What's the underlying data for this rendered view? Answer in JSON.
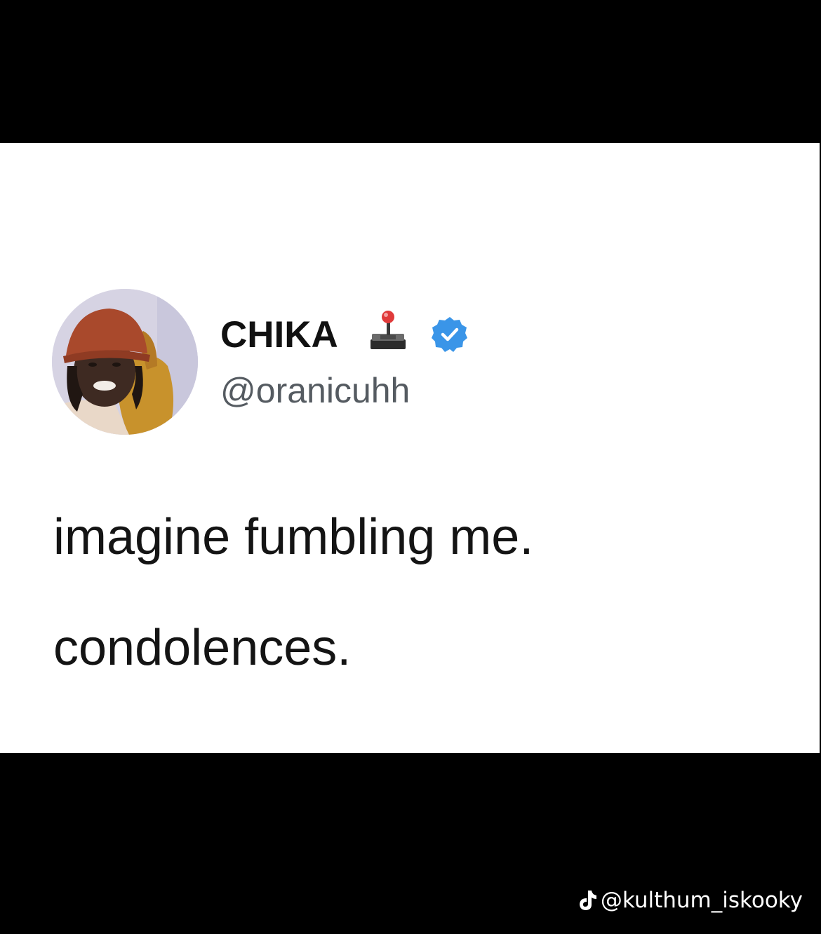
{
  "post": {
    "author": {
      "display_name": "CHIKA",
      "handle": "@oranicuhh",
      "emoji_icon": "joystick-icon",
      "badge_icon": "verified-badge-icon",
      "badge_color": "#3a95e8"
    },
    "text_lines": [
      "imagine fumbling me.",
      "condolences."
    ]
  },
  "watermark": {
    "platform_icon": "tiktok-icon",
    "text": "@kulthum_iskooky"
  },
  "colors": {
    "background_bars": "#000000",
    "panel": "#ffffff",
    "text_primary": "#141414",
    "text_secondary": "#555b61"
  }
}
